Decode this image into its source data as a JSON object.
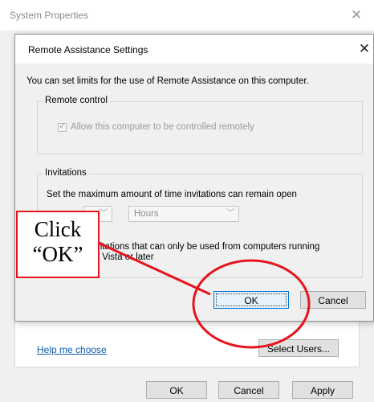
{
  "outer_window": {
    "title": "System Properties",
    "close_glyph": "✕",
    "help_link": "Help me choose",
    "select_users_label": "Select Users...",
    "ok_label": "OK",
    "cancel_label": "Cancel",
    "apply_label": "Apply"
  },
  "dialog": {
    "title": "Remote Assistance Settings",
    "close_glyph": "✕",
    "intro": "You can set limits for the use of Remote Assistance on this computer.",
    "remote_control": {
      "group_label": "Remote control",
      "allow_label": "Allow this computer to be controlled remotely",
      "allow_checked": true
    },
    "invitations": {
      "group_label": "Invitations",
      "text": "Set the maximum amount of time invitations can remain open",
      "unit_value": "Hours",
      "vista_line1": "invitations that can only be used from computers running",
      "vista_line2": "ws Vista or later"
    },
    "ok_label": "OK",
    "cancel_label": "Cancel"
  },
  "annotation": {
    "line1": "Click",
    "line2": "“OK”",
    "color": "#e5141d"
  },
  "icons": {
    "close": "close-icon",
    "checkbox": "check-icon",
    "dropdown": "chevron-down-icon"
  }
}
